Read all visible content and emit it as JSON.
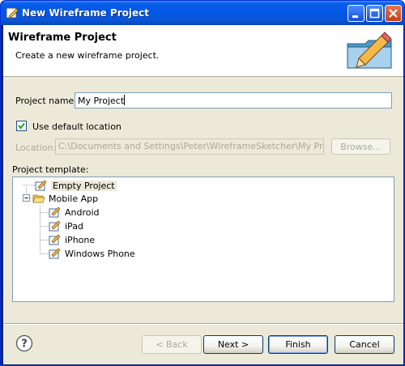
{
  "window": {
    "title": "New Wireframe Project"
  },
  "header": {
    "title": "Wireframe Project",
    "description": "Create a new wireframe project."
  },
  "form": {
    "project_name_label": "Project name:",
    "project_name_value": "My Project",
    "use_default_location_label": "Use default location",
    "use_default_location_checked": true,
    "location_label": "Location:",
    "location_value": "C:\\Documents and Settings\\Peter\\WireframeSketcher\\My Project",
    "browse_label": "Browse...",
    "project_template_label": "Project template:"
  },
  "templates": {
    "items": [
      {
        "label": "Empty Project",
        "selected": true
      },
      {
        "label": "Mobile App",
        "expanded": true
      },
      {
        "label": "Android"
      },
      {
        "label": "iPad"
      },
      {
        "label": "iPhone"
      },
      {
        "label": "Windows Phone"
      }
    ]
  },
  "footer": {
    "back_label": "< Back",
    "next_label": "Next >",
    "finish_label": "Finish",
    "cancel_label": "Cancel"
  },
  "colors": {
    "titlebar": "#0058e6",
    "dialog_bg": "#ece9d8",
    "checkbox_check": "#21a121"
  }
}
